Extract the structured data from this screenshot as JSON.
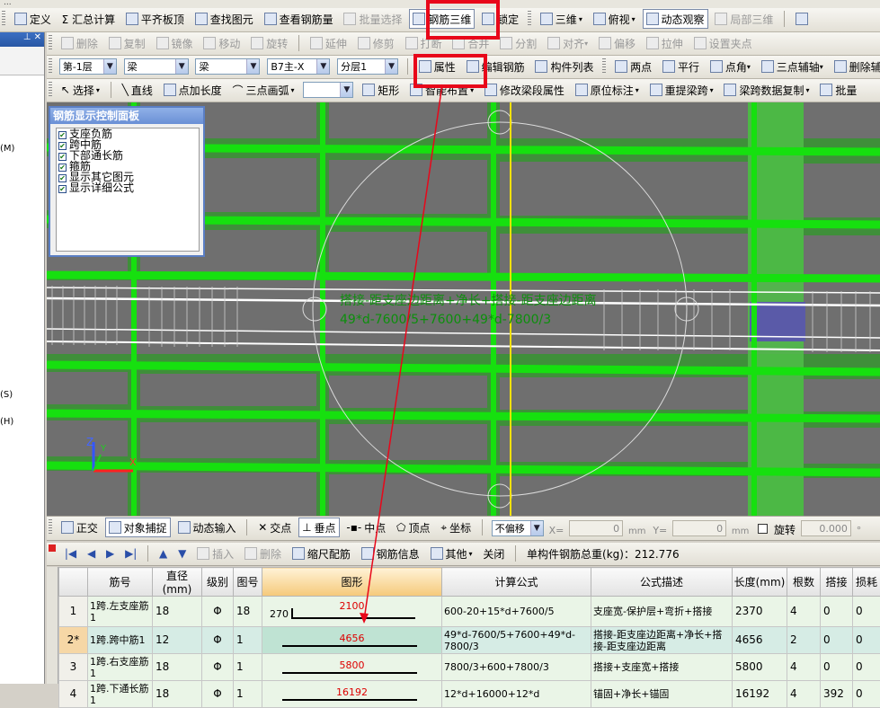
{
  "menu_fragment": "...",
  "toolbar1": {
    "items": [
      "定义",
      "Σ 汇总计算",
      "平齐板顶",
      "查找图元",
      "查看钢筋量",
      "批量选择",
      "钢筋三维",
      "锁定",
      "三维",
      "俯视",
      "动态观察",
      "局部三维"
    ]
  },
  "toolbar2": {
    "items": [
      "删除",
      "复制",
      "镜像",
      "移动",
      "旋转",
      "延伸",
      "修剪",
      "打断",
      "合并",
      "分割",
      "对齐",
      "偏移",
      "拉伸",
      "设置夹点"
    ]
  },
  "toolbar3": {
    "floor": "第-1层",
    "type1": "梁",
    "type2": "梁",
    "element": "B7主-X",
    "layer": "分层1",
    "items": [
      "属性",
      "编辑钢筋",
      "构件列表",
      "两点",
      "平行",
      "点角",
      "三点辅轴",
      "删除辅轴"
    ]
  },
  "toolbar4": {
    "items": [
      "选择",
      "直线",
      "点加长度",
      "三点画弧",
      "矩形",
      "智能布置",
      "修改梁段属性",
      "原位标注",
      "重提梁跨",
      "梁跨数据复制",
      "批量"
    ]
  },
  "left_panel": {
    "close": "✕",
    "labels": [
      "(M)",
      "(S)",
      "(H)"
    ]
  },
  "control_panel": {
    "title": "钢筋显示控制面板",
    "items": [
      "支座负筋",
      "跨中筋",
      "下部通长筋",
      "箍筋",
      "显示其它图元",
      "显示详细公式"
    ]
  },
  "canvas": {
    "formula_label": "搭接-距支座边距离+净长+搭接-距支座边距离",
    "formula_expr": "49*d-7600/5+7600+49*d-7800/3",
    "axis_z": "Z",
    "axis_x": "X",
    "axis_y": "Y"
  },
  "snap_bar": {
    "items": [
      "正交",
      "对象捕捉",
      "动态输入",
      "交点",
      "垂点",
      "中点",
      "顶点",
      "坐标"
    ],
    "offset_mode": "不偏移",
    "x_label": "X=",
    "x_value": "0",
    "y_label": "Y=",
    "y_value": "0",
    "unit": "mm",
    "rotate_label": "旋转",
    "rotate_value": "0.000",
    "degree": "°"
  },
  "table_bar": {
    "items": [
      "插入",
      "删除",
      "缩尺配筋",
      "钢筋信息",
      "其他",
      "关闭"
    ],
    "total_label": "单构件钢筋总重(kg)：212.776"
  },
  "table": {
    "headers": [
      "筋号",
      "直径(mm)",
      "级别",
      "图号",
      "图形",
      "计算公式",
      "公式描述",
      "长度(mm)",
      "根数",
      "搭接",
      "损耗"
    ],
    "rows": [
      {
        "no": "1",
        "name": "1跨.左支座筋1",
        "dia": "18",
        "grade": "Φ",
        "fig": "18",
        "hook": "270",
        "len_label": "2100",
        "formula": "600-20+15*d+7600/5",
        "desc": "支座宽-保护层+弯折+搭接",
        "length": "2370",
        "count": "4",
        "lap": "0",
        "loss": "0"
      },
      {
        "no": "2*",
        "name": "1跨.跨中筋1",
        "dia": "12",
        "grade": "Φ",
        "fig": "1",
        "hook": "",
        "len_label": "4656",
        "formula": "49*d-7600/5+7600+49*d-7800/3",
        "desc": "搭接-距支座边距离+净长+搭接-距支座边距离",
        "length": "4656",
        "count": "2",
        "lap": "0",
        "loss": "0"
      },
      {
        "no": "3",
        "name": "1跨.右支座筋1",
        "dia": "18",
        "grade": "Φ",
        "fig": "1",
        "hook": "",
        "len_label": "5800",
        "formula": "7800/3+600+7800/3",
        "desc": "搭接+支座宽+搭接",
        "length": "5800",
        "count": "4",
        "lap": "0",
        "loss": "0"
      },
      {
        "no": "4",
        "name": "1跨.下通长筋1",
        "dia": "18",
        "grade": "Φ",
        "fig": "1",
        "hook": "",
        "len_label": "16192",
        "formula": "12*d+16000+12*d",
        "desc": "锚固+净长+锚固",
        "length": "16192",
        "count": "4",
        "lap": "392",
        "loss": "0"
      }
    ]
  },
  "colors": {
    "highlight": "#e8071a",
    "rebar_green": "#16e00f",
    "concrete_gray": "#6f6f6f",
    "table_bg": "#eaf5e7"
  }
}
